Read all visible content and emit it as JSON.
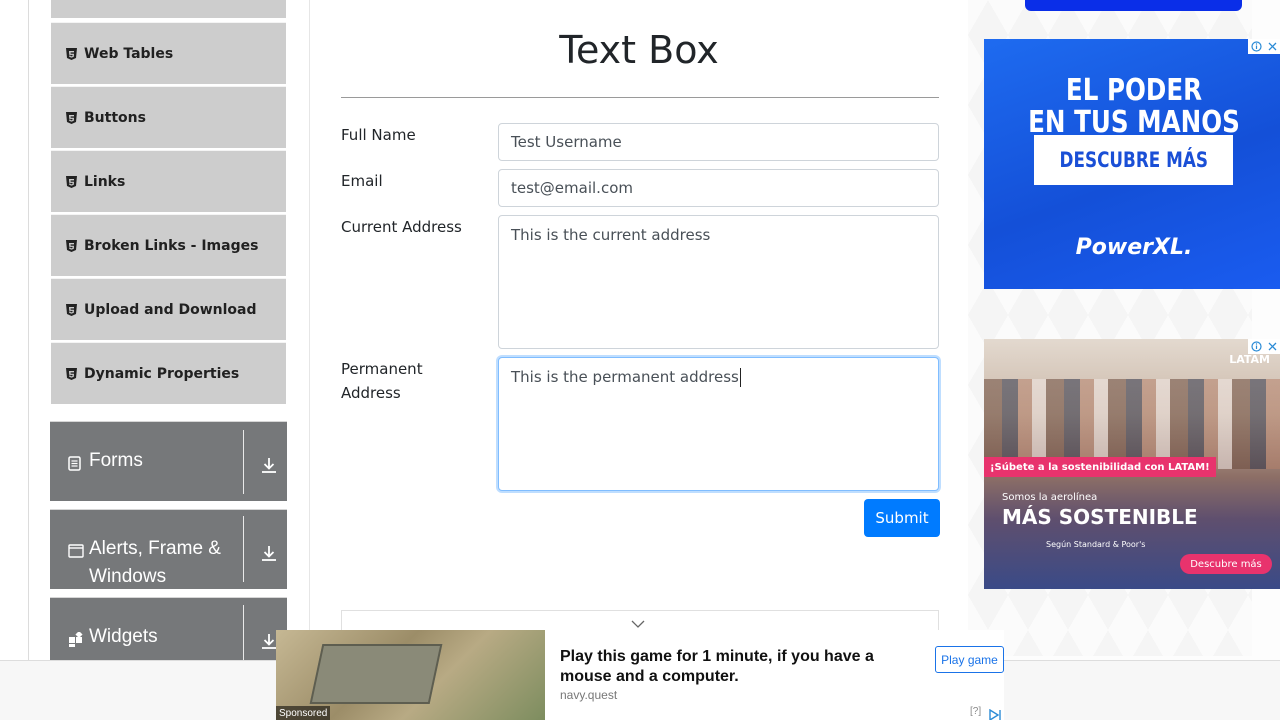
{
  "sidebar": {
    "elements_items": [
      {
        "label": "Web Tables"
      },
      {
        "label": "Buttons"
      },
      {
        "label": "Links"
      },
      {
        "label": "Broken Links - Images"
      },
      {
        "label": "Upload and Download"
      },
      {
        "label": "Dynamic Properties"
      }
    ],
    "groups": [
      {
        "label": "Forms",
        "icon": "form-icon"
      },
      {
        "label": "Alerts, Frame & Windows",
        "label_line1": "Alerts, Frame &",
        "label_line2": "Windows",
        "icon": "window-icon"
      },
      {
        "label": "Widgets",
        "icon": "widgets-icon"
      }
    ],
    "group_color": "#76787a",
    "item_color": "#cdcdcd"
  },
  "main": {
    "title": "Text Box",
    "form": {
      "full_name": {
        "label": "Full Name",
        "value": "Test Username"
      },
      "email": {
        "label": "Email",
        "value": "test@email.com"
      },
      "current_address": {
        "label": "Current Address",
        "value": "This is the current address"
      },
      "permanent_address": {
        "label": "Permanent Address",
        "label_line1": "Permanent",
        "label_line2": "Address",
        "value": "This is the permanent address"
      },
      "submit_label": "Submit"
    },
    "accent_color": "#007bff"
  },
  "ads": {
    "ad1": {
      "headline_line1": "EL PODER",
      "headline_line2": "EN TUS MANOS",
      "cta": "DESCUBRE MÁS",
      "brand": "PowerXL."
    },
    "ad2": {
      "logo": "LATAM",
      "pill": "¡Súbete a la sostenibilidad con LATAM!",
      "small": "Somos la aerolínea",
      "big": "MÁS SOSTENIBLE",
      "sub": "Según Standard & Poor's",
      "cta": "Descubre más"
    }
  },
  "sponsored": {
    "label": "Sponsored",
    "headline": "Play this game for 1 minute, if you have a mouse and a computer.",
    "domain": "navy.quest",
    "cta": "Play game",
    "help": "[?]"
  }
}
